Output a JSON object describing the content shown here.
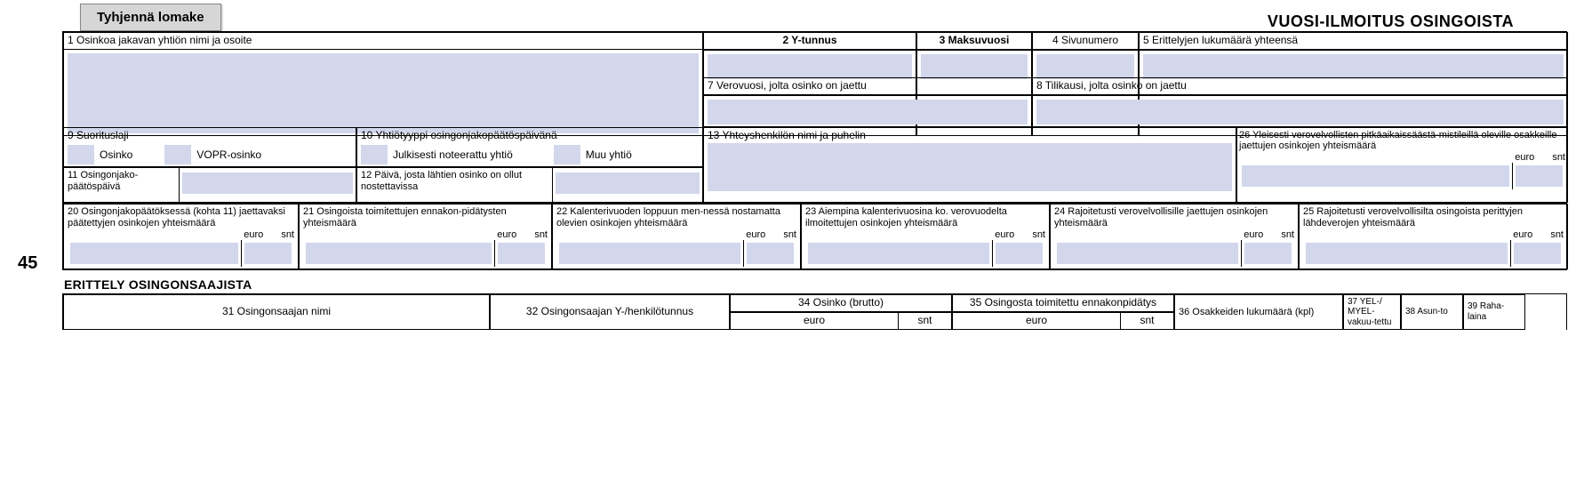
{
  "ui": {
    "clear_button": "Tyhjennä lomake",
    "title": "VUOSI-ILMOITUS OSINGOISTA",
    "margin_number": "45",
    "section_heading": "ERITTELY OSINGONSAAJISTA"
  },
  "fields": {
    "f1": "1 Osinkoa jakavan yhtiön nimi ja osoite",
    "f2": "2 Y-tunnus",
    "f3": "3 Maksuvuosi",
    "f4": "4 Sivunumero",
    "f5": "5 Erittelyjen lukumäärä yhteensä",
    "f7": "7 Verovuosi, jolta osinko on jaettu",
    "f8": "8 Tilikausi, jolta osinko on jaettu",
    "f9": "9 Suorituslaji",
    "f9_osinko": "Osinko",
    "f9_vopr": "VOPR-osinko",
    "f10": "10 Yhtiötyyppi osingonjakopäätöspäivänä",
    "f10_julk": "Julkisesti noteerattu yhtiö",
    "f10_muu": "Muu yhtiö",
    "f11": "11 Osingonjako-päätöspäivä",
    "f12": "12 Päivä, josta lähtien osinko on ollut nostettavissa",
    "f13": "13 Yhteyshenkilön nimi ja puhelin",
    "f20": "20 Osingonjakopäätöksessä (kohta 11) jaettavaksi päätettyjen osinkojen yhteismäärä",
    "f21": "21 Osingoista toimitettujen ennakon-pidätysten yhteismäärä",
    "f22": "22 Kalenterivuoden loppuun men-nessä nostamatta olevien osinkojen yhteismäärä",
    "f23": "23 Aiempina kalenterivuosina ko. verovuodelta ilmoitettujen osinkojen yhteismäärä",
    "f24": "24 Rajoitetusti verovelvollisille jaettujen osinkojen yhteismäärä",
    "f25": "25 Rajoitetusti verovelvollisilta osingoista perittyjen lähdeverojen yhteismäärä",
    "f26": "26 Yleisesti verovelvollisten pitkäaikaissäästä-mistileillä oleville osakkeille jaettujen osinkojen yhteismäärä",
    "euro": "euro",
    "snt": "snt",
    "f31": "31 Osingonsaajan nimi",
    "f32": "32 Osingonsaajan Y-/henkilötunnus",
    "f34": "34 Osinko (brutto)",
    "f35": "35 Osingosta toimitettu ennakonpidätys",
    "f36": "36 Osakkeiden lukumäärä (kpl)",
    "f37": "37 YEL-/ MYEL-vakuu-tettu",
    "f38": "38 Asun-to",
    "f39": "39 Raha-laina"
  },
  "chart_data": {
    "type": "table",
    "title": "VUOSI-ILMOITUS OSINGOISTA",
    "fields": [
      {
        "num": 1,
        "label_fi": "Osinkoa jakavan yhtiön nimi ja osoite",
        "type": "text"
      },
      {
        "num": 2,
        "label_fi": "Y-tunnus",
        "type": "text",
        "emphasis": "bold"
      },
      {
        "num": 3,
        "label_fi": "Maksuvuosi",
        "type": "year",
        "emphasis": "bold"
      },
      {
        "num": 4,
        "label_fi": "Sivunumero",
        "type": "int"
      },
      {
        "num": 5,
        "label_fi": "Erittelyjen lukumäärä yhteensä",
        "type": "int"
      },
      {
        "num": 7,
        "label_fi": "Verovuosi, jolta osinko on jaettu",
        "type": "year"
      },
      {
        "num": 8,
        "label_fi": "Tilikausi, jolta osinko on jaettu",
        "type": "daterange"
      },
      {
        "num": 9,
        "label_fi": "Suorituslaji",
        "type": "checkbox",
        "options": [
          "Osinko",
          "VOPR-osinko"
        ]
      },
      {
        "num": 10,
        "label_fi": "Yhtiötyyppi osingonjakopäätöspäivänä",
        "type": "checkbox",
        "options": [
          "Julkisesti noteerattu yhtiö",
          "Muu yhtiö"
        ]
      },
      {
        "num": 11,
        "label_fi": "Osingonjakopäätöspäivä",
        "type": "date"
      },
      {
        "num": 12,
        "label_fi": "Päivä, josta lähtien osinko on ollut nostettavissa",
        "type": "date"
      },
      {
        "num": 13,
        "label_fi": "Yhteyshenkilön nimi ja puhelin",
        "type": "text"
      },
      {
        "num": 20,
        "label_fi": "Osingonjakopäätöksessä (kohta 11) jaettavaksi päätettyjen osinkojen yhteismäärä",
        "type": "currency"
      },
      {
        "num": 21,
        "label_fi": "Osingoista toimitettujen ennakonpidätysten yhteismäärä",
        "type": "currency"
      },
      {
        "num": 22,
        "label_fi": "Kalenterivuoden loppuun mennessä nostamatta olevien osinkojen yhteismäärä",
        "type": "currency"
      },
      {
        "num": 23,
        "label_fi": "Aiempina kalenterivuosina ko. verovuodelta ilmoitettujen osinkojen yhteismäärä",
        "type": "currency"
      },
      {
        "num": 24,
        "label_fi": "Rajoitetusti verovelvollisille jaettujen osinkojen yhteismäärä",
        "type": "currency"
      },
      {
        "num": 25,
        "label_fi": "Rajoitetusti verovelvollisilta osingoista perittyjen lähdeverojen yhteismäärä",
        "type": "currency"
      },
      {
        "num": 26,
        "label_fi": "Yleisesti verovelvollisten pitkäaikaissäästämistileillä oleville osakkeille jaettujen osinkojen yhteismäärä",
        "type": "currency"
      }
    ],
    "detail_columns": [
      {
        "num": 31,
        "label_fi": "Osingonsaajan nimi",
        "type": "text"
      },
      {
        "num": 32,
        "label_fi": "Osingonsaajan Y-/henkilötunnus",
        "type": "text"
      },
      {
        "num": 34,
        "label_fi": "Osinko (brutto)",
        "type": "currency"
      },
      {
        "num": 35,
        "label_fi": "Osingosta toimitettu ennakonpidätys",
        "type": "currency"
      },
      {
        "num": 36,
        "label_fi": "Osakkeiden lukumäärä (kpl)",
        "type": "int"
      },
      {
        "num": 37,
        "label_fi": "YEL-/MYEL-vakuutettu",
        "type": "checkbox"
      },
      {
        "num": 38,
        "label_fi": "Asunto",
        "type": "checkbox"
      },
      {
        "num": 39,
        "label_fi": "Rahalaina",
        "type": "checkbox"
      }
    ]
  }
}
